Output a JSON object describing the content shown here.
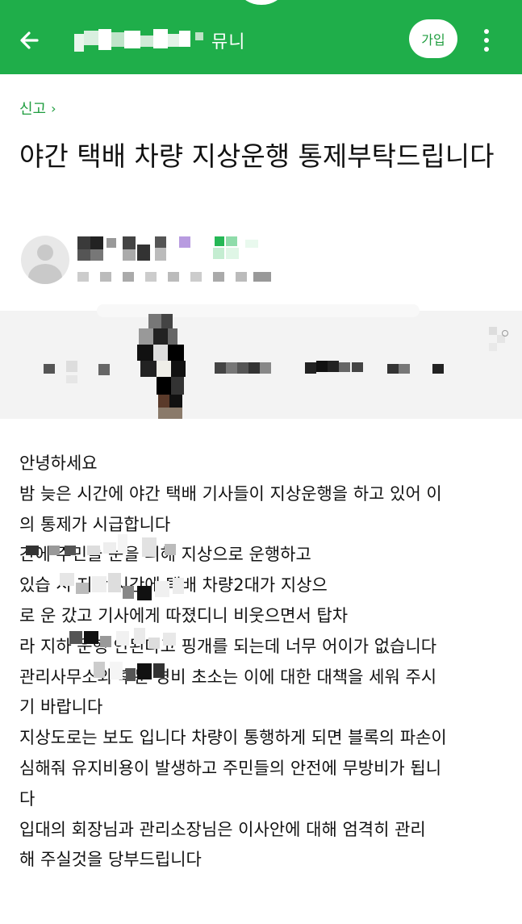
{
  "header": {
    "cafe_name_suffix": "뮤니",
    "join_label": "가입",
    "back_icon": "arrow-left-icon",
    "more_icon": "more-vertical-icon",
    "bar_color": "#1fae4a"
  },
  "breadcrumb": {
    "label": "신고",
    "chevron": "›"
  },
  "post": {
    "title": "야간 택배 차량 지상운행 통제부탁드립니다",
    "body_lines": [
      "안녕하세요",
      "밤 늦은 시간에 야간 택배 기사들이 지상운행을 하고  있어 이",
      "의 통제가 시급합니다",
      "           간에 주민들 눈을 피해 지상으로 운행하고",
      "있습             시 지난 시간에 택배 차량2대가 지상으",
      "로 운            갔고 기사에게 따졌디니 비웃으면서 탑차",
      "라 지하 운행     안된다고 핑개를 되는데 너무 어이가 없습니다",
      "관리사무소와 후문 경비 초소는 이에 대한 대책을 세워 주시",
      "기 바랍니다",
      "지상도로는 보도 입니다 차량이 통행하게 되면 블록의 파손이",
      "심해줘 유지비용이 발생하고 주민들의 안전에 무방비가 됩니",
      "다",
      "입대의 회장님과 관리소장님은  이사안에 대해 엄격히 관리",
      "해 주실것을 당부드립니다"
    ]
  },
  "author": {
    "avatar_icon": "default-avatar-icon"
  },
  "colors": {
    "accent": "#1f9d3f",
    "banner_bg": "#f3f3f3"
  }
}
